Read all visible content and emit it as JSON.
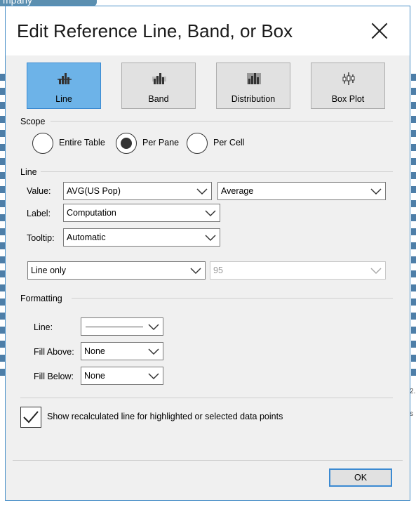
{
  "background": {
    "tab_text": "mpany",
    "side_text": "2.",
    "side_text2": "s"
  },
  "dialog": {
    "title": "Edit Reference Line, Band, or Box",
    "close_icon": "close-icon"
  },
  "type_buttons": [
    {
      "label": "Line",
      "icon": "line-chart-icon",
      "selected": true
    },
    {
      "label": "Band",
      "icon": "band-chart-icon",
      "selected": false
    },
    {
      "label": "Distribution",
      "icon": "distribution-chart-icon",
      "selected": false
    },
    {
      "label": "Box Plot",
      "icon": "box-plot-icon",
      "selected": false
    }
  ],
  "scope": {
    "label": "Scope",
    "options": [
      {
        "label": "Entire Table",
        "selected": false
      },
      {
        "label": "Per Pane",
        "selected": true
      },
      {
        "label": "Per Cell",
        "selected": false
      }
    ]
  },
  "line_section": {
    "label": "Line",
    "value_label": "Value:",
    "value_field": "AVG(US Pop)",
    "aggregation": "Average",
    "label_label": "Label:",
    "label_value": "Computation",
    "tooltip_label": "Tooltip:",
    "tooltip_value": "Automatic",
    "line_mode": "Line only",
    "confidence": "95"
  },
  "formatting": {
    "label": "Formatting",
    "line_label": "Line:",
    "fill_above_label": "Fill Above:",
    "fill_above_value": "None",
    "fill_below_label": "Fill Below:",
    "fill_below_value": "None"
  },
  "recalc": {
    "checked": true,
    "label": "Show recalculated line for highlighted or selected data points"
  },
  "footer": {
    "ok_label": "OK"
  },
  "colors": {
    "accent": "#3b8ad2",
    "selected_bg": "#6db3e8",
    "dialog_bg": "#f0f0f0"
  }
}
